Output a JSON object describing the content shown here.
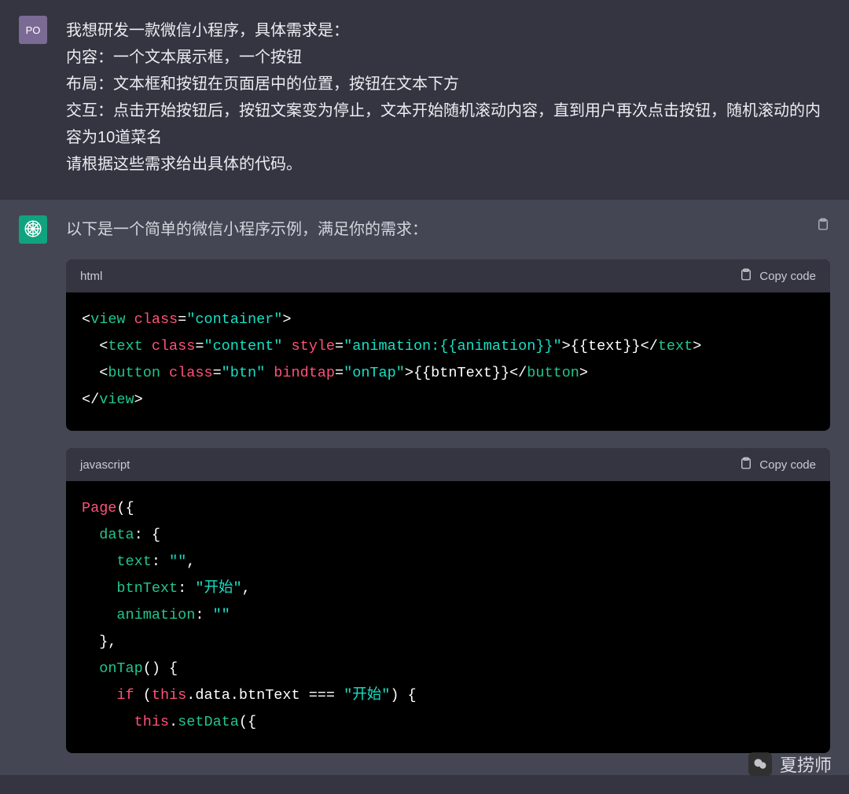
{
  "user": {
    "avatar_label": "PO",
    "message": "我想研发一款微信小程序，具体需求是：\n内容：一个文本展示框，一个按钮\n布局：文本框和按钮在页面居中的位置，按钮在文本下方\n交互：点击开始按钮后，按钮文案变为停止，文本开始随机滚动内容，直到用户再次点击按钮，随机滚动的内容为10道菜名\n请根据这些需求给出具体的代码。"
  },
  "assistant": {
    "intro": "以下是一个简单的微信小程序示例，满足你的需求："
  },
  "code_blocks": [
    {
      "language_label": "html",
      "copy_label": "Copy code",
      "raw": "<view class=\"container\">\n  <text class=\"content\" style=\"animation:{{animation}}\">{{text}}</text>\n  <button class=\"btn\" bindtap=\"onTap\">{{btnText}}</button>\n</view>",
      "tokens": [
        [
          [
            "<",
            "punc"
          ],
          [
            "view",
            "tag"
          ],
          [
            " ",
            "plain"
          ],
          [
            "class",
            "attr"
          ],
          [
            "=",
            "punc"
          ],
          [
            "\"container\"",
            "str"
          ],
          [
            ">",
            "punc"
          ]
        ],
        [
          [
            "  <",
            "punc"
          ],
          [
            "text",
            "tag"
          ],
          [
            " ",
            "plain"
          ],
          [
            "class",
            "attr"
          ],
          [
            "=",
            "punc"
          ],
          [
            "\"content\"",
            "str"
          ],
          [
            " ",
            "plain"
          ],
          [
            "style",
            "attr"
          ],
          [
            "=",
            "punc"
          ],
          [
            "\"animation:{{animation}}\"",
            "str"
          ],
          [
            ">",
            "punc"
          ],
          [
            "{{text}}",
            "plain"
          ],
          [
            "</",
            "punc"
          ],
          [
            "text",
            "tag"
          ],
          [
            ">",
            "punc"
          ]
        ],
        [
          [
            "  <",
            "punc"
          ],
          [
            "button",
            "tag"
          ],
          [
            " ",
            "plain"
          ],
          [
            "class",
            "attr"
          ],
          [
            "=",
            "punc"
          ],
          [
            "\"btn\"",
            "str"
          ],
          [
            " ",
            "plain"
          ],
          [
            "bindtap",
            "attr"
          ],
          [
            "=",
            "punc"
          ],
          [
            "\"onTap\"",
            "str"
          ],
          [
            ">",
            "punc"
          ],
          [
            "{{btnText}}",
            "plain"
          ],
          [
            "</",
            "punc"
          ],
          [
            "button",
            "tag"
          ],
          [
            ">",
            "punc"
          ]
        ],
        [
          [
            "</",
            "punc"
          ],
          [
            "view",
            "tag"
          ],
          [
            ">",
            "punc"
          ]
        ]
      ]
    },
    {
      "language_label": "javascript",
      "copy_label": "Copy code",
      "raw": "Page({\n  data: {\n    text: \"\",\n    btnText: \"开始\",\n    animation: \"\"\n  },\n  onTap() {\n    if (this.data.btnText === \"开始\") {\n      this.setData({",
      "tokens": [
        [
          [
            "Page",
            "kw"
          ],
          [
            "({",
            "plain"
          ]
        ],
        [
          [
            "  ",
            "plain"
          ],
          [
            "data",
            "prop"
          ],
          [
            ": {",
            "plain"
          ]
        ],
        [
          [
            "    ",
            "plain"
          ],
          [
            "text",
            "prop"
          ],
          [
            ": ",
            "plain"
          ],
          [
            "\"\"",
            "str"
          ],
          [
            ",",
            "plain"
          ]
        ],
        [
          [
            "    ",
            "plain"
          ],
          [
            "btnText",
            "prop"
          ],
          [
            ": ",
            "plain"
          ],
          [
            "\"开始\"",
            "str"
          ],
          [
            ",",
            "plain"
          ]
        ],
        [
          [
            "    ",
            "plain"
          ],
          [
            "animation",
            "prop"
          ],
          [
            ": ",
            "plain"
          ],
          [
            "\"\"",
            "str"
          ]
        ],
        [
          [
            "  },",
            "plain"
          ]
        ],
        [
          [
            "  ",
            "plain"
          ],
          [
            "onTap",
            "prop"
          ],
          [
            "() {",
            "plain"
          ]
        ],
        [
          [
            "    ",
            "plain"
          ],
          [
            "if",
            "kw"
          ],
          [
            " (",
            "plain"
          ],
          [
            "this",
            "kw"
          ],
          [
            ".data.btnText === ",
            "plain"
          ],
          [
            "\"开始\"",
            "str"
          ],
          [
            ") {",
            "plain"
          ]
        ],
        [
          [
            "      ",
            "plain"
          ],
          [
            "this",
            "kw"
          ],
          [
            ".",
            "plain"
          ],
          [
            "setData",
            "prop"
          ],
          [
            "({",
            "plain"
          ]
        ]
      ]
    }
  ],
  "watermark": {
    "label": "夏捞师"
  }
}
